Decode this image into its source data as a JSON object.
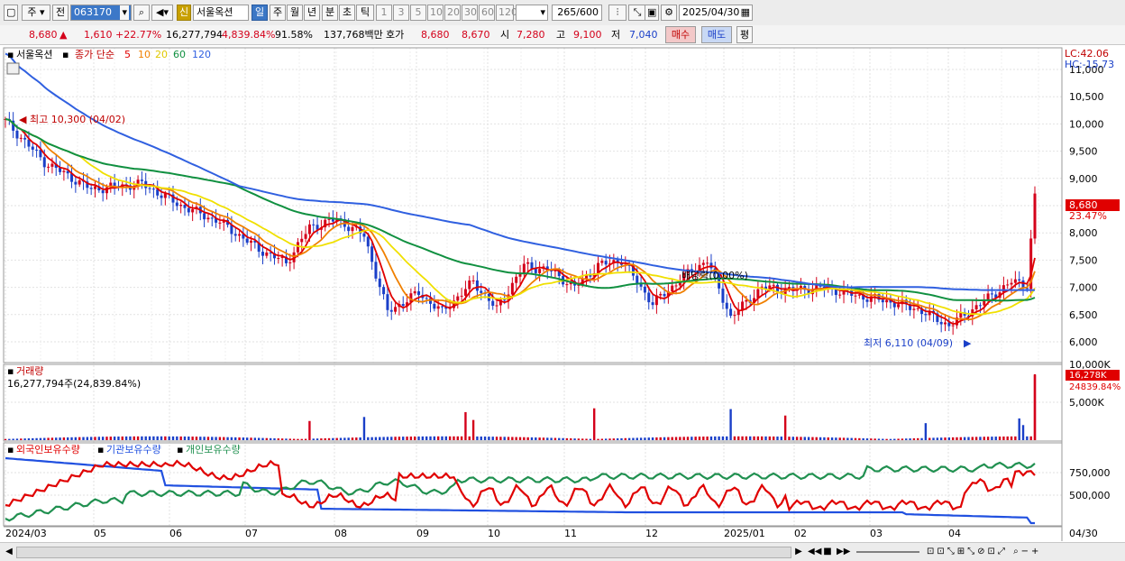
{
  "toolbar": {
    "layout_icon": "window-icon",
    "market": "주",
    "scope": "전",
    "code": "063170",
    "search_icon": "search-icon",
    "sound_icon": "speaker-icon",
    "new_badge": "신",
    "name": "서울옥션",
    "periods": [
      "일",
      "주",
      "월",
      "년",
      "분",
      "초",
      "틱"
    ],
    "active_period": "일",
    "intervals": [
      "1",
      "3",
      "5",
      "10",
      "20",
      "30",
      "60",
      "120"
    ],
    "count": "265",
    "count_total": "/600",
    "date": "2025/04/30"
  },
  "info": {
    "price": "8,680",
    "arrow": "▲",
    "change": "1,610",
    "change_pct": "+22.77%",
    "volume": "16,277,794",
    "volume_ratio": "4,839.84%",
    "turnover": "91.58%",
    "amount": "137,768백만",
    "hoga_label": "호가",
    "ask": "8,680",
    "bid": "8,670",
    "open_label": "시",
    "open": "7,280",
    "high_label": "고",
    "high": "9,100",
    "low_label": "저",
    "low": "7,040",
    "buy_label": "매수",
    "sell_label": "매도",
    "avg_label": "평"
  },
  "price_panel": {
    "title": "서울옥션",
    "ma_label": "종가 단순",
    "ma_periods": [
      "5",
      "10",
      "20",
      "60",
      "120"
    ],
    "ma_colors": [
      "#e00000",
      "#f08000",
      "#f0e000",
      "#109040",
      "#3060e0"
    ],
    "lc": "LC:42.06",
    "hc": "HC:-15.73",
    "y_ticks": [
      "11,000",
      "10,500",
      "10,000",
      "9,500",
      "9,000",
      "8,500",
      "8,000",
      "7,500",
      "7,000",
      "6,500",
      "6,000"
    ],
    "current_price_tag": "8,680",
    "current_pct_tag": "23.47%",
    "high_note": "최고 10,300 (04/02)",
    "low_note": "최저 6,110 (04/09)",
    "dividend_note": "배당락(0.00%)"
  },
  "volume_panel": {
    "title": "거래량",
    "summary": "16,277,794주(24,839.84%)",
    "tag": "16,278K",
    "tag_pct": "24839.84%",
    "y_ticks": [
      "10,000K",
      "5,000K"
    ]
  },
  "holdings_panel": {
    "series_labels": [
      "외국인보유수량",
      "기관보유수량",
      "개인보유수량"
    ],
    "series_colors": [
      "#e00000",
      "#2050e0",
      "#209050"
    ],
    "y_ticks": [
      "750,000",
      "500,000"
    ]
  },
  "x_axis": {
    "labels": [
      "2024/03",
      "05",
      "06",
      "07",
      "08",
      "09",
      "10",
      "11",
      "12",
      "2025/01",
      "02",
      "03",
      "04"
    ],
    "last_label": "04/30"
  },
  "colors": {
    "up": "#d4001a",
    "down": "#1a3fc8",
    "grid": "#d8d8d8"
  }
}
